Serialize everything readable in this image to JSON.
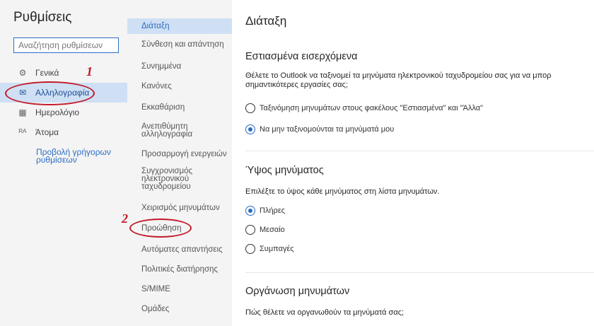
{
  "settings_title": "Ρυθμίσεις",
  "search": {
    "placeholder": "Αναζήτηση ρυθμίσεων"
  },
  "left_nav": [
    {
      "label": "Γενικά",
      "icon": "gear-icon"
    },
    {
      "label": "Αλληλογραφία",
      "icon": "mail-icon"
    },
    {
      "label": "Ημερολόγιο",
      "icon": "calendar-icon"
    },
    {
      "label": "Άτομα",
      "icon": "people-icon"
    }
  ],
  "quick_settings_link": "Προβολή γρήγορων ρυθμίσεων",
  "mail_nav": [
    "Διάταξη",
    "Σύνθεση και απάντηση",
    "Συνημμένα",
    "Κανόνες",
    "Εκκαθάριση",
    "Ανεπιθύμητη αλληλογραφία",
    "Προσαρμογή ενεργειών",
    "Συγχρονισμός ηλεκτρονικού ταχυδρομείου",
    "Χειρισμός μηνυμάτων",
    "Προώθηση",
    "Αυτόματες απαντήσεις",
    "Πολιτικές διατήρησης",
    "S/MIME",
    "Ομάδες"
  ],
  "content": {
    "title": "Διάταξη",
    "focused": {
      "heading": "Εστιασμένα εισερχόμενα",
      "desc_line1": "Θέλετε το Outlook να ταξινομεί τα μηνύματα ηλεκτρονικού ταχυδρομείου σας για να μπορ",
      "desc_line2": "σημαντικότερες εργασίες σας;",
      "options": [
        "Ταξινόμηση μηνυμάτων στους φακέλους \"Εστιασμένα\" και \"Άλλα\"",
        "Να μην ταξινομούνται τα μηνύματά μου"
      ],
      "selected_index": 1
    },
    "height": {
      "heading": "Ύψος μηνύματος",
      "desc": "Επιλέξτε το ύψος κάθε μηνύματος στη λίστα μηνυμάτων.",
      "options": [
        "Πλήρες",
        "Μεσαίο",
        "Συμπαγές"
      ],
      "selected_index": 0
    },
    "organization": {
      "heading": "Οργάνωση μηνυμάτων",
      "desc": "Πώς θέλετε να οργανωθούν τα μηνύματά σας;"
    }
  },
  "annotations": {
    "step1": "1",
    "step2": "2",
    "color": "#c21a2a"
  },
  "colors": {
    "accent": "#2c6cc4",
    "selected_bg": "#cfe0f4",
    "pane_bg": "#f4f4f4"
  }
}
